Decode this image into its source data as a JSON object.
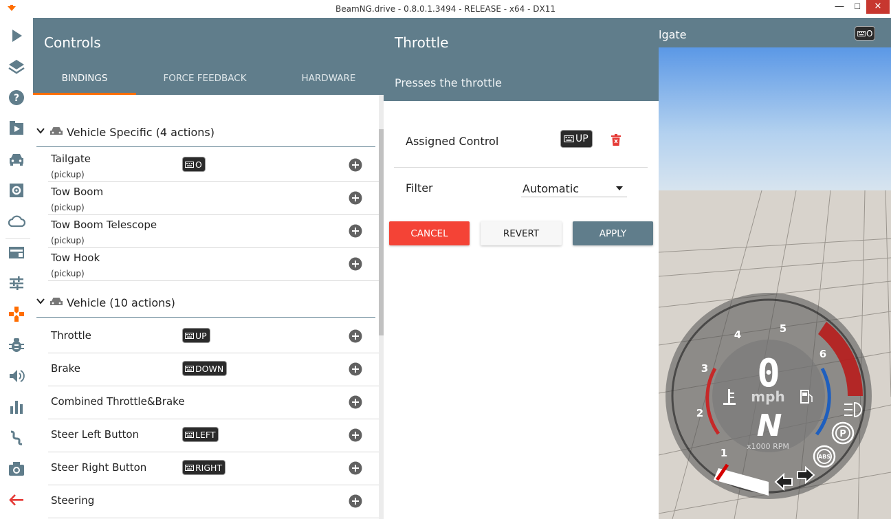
{
  "window": {
    "title": "BeamNG.drive - 0.8.0.1.3494 - RELEASE - x64 - DX11",
    "min_symbol": "—",
    "max_symbol": "□",
    "close_symbol": "✕"
  },
  "sidebar": {
    "items": [
      {
        "icon": "play-icon"
      },
      {
        "icon": "layers-icon"
      },
      {
        "icon": "help-icon"
      },
      {
        "icon": "scenario-icon"
      },
      {
        "icon": "car-icon"
      },
      {
        "icon": "vehicle-config-icon"
      },
      {
        "icon": "weather-cloud-icon"
      },
      {
        "icon": "ui-apps-icon"
      },
      {
        "icon": "options-sliders-icon"
      },
      {
        "icon": "controls-gamepad-icon",
        "active": true
      },
      {
        "icon": "debug-bug-icon"
      },
      {
        "icon": "audio-volume-icon"
      },
      {
        "icon": "performance-chart-icon"
      },
      {
        "icon": "track-builder-icon"
      },
      {
        "icon": "camera-icon"
      },
      {
        "icon": "back-arrow-icon"
      }
    ],
    "accent_color": "#ff6d00"
  },
  "controls": {
    "title": "Controls",
    "tabs": [
      {
        "label": "BINDINGS",
        "active": true
      },
      {
        "label": "FORCE FEEDBACK"
      },
      {
        "label": "HARDWARE"
      }
    ],
    "header_color": "#607d8b",
    "groups": [
      {
        "label": "Vehicle Specific (4 actions)",
        "actions": [
          {
            "name": "Tailgate",
            "sub": "(pickup)",
            "key": "O"
          },
          {
            "name": "Tow Boom",
            "sub": "(pickup)",
            "key": ""
          },
          {
            "name": "Tow Boom Telescope",
            "sub": "(pickup)",
            "key": ""
          },
          {
            "name": "Tow Hook",
            "sub": "(pickup)",
            "key": ""
          }
        ]
      },
      {
        "label": "Vehicle (10 actions)",
        "actions": [
          {
            "name": "Throttle",
            "key": "UP"
          },
          {
            "name": "Brake",
            "key": "DOWN"
          },
          {
            "name": "Combined Throttle&Brake",
            "key": ""
          },
          {
            "name": "Steer Left Button",
            "key": "LEFT"
          },
          {
            "name": "Steer Right Button",
            "key": "RIGHT"
          },
          {
            "name": "Steering",
            "key": ""
          }
        ]
      }
    ]
  },
  "throttle": {
    "title": "Throttle",
    "description": "Presses the throttle",
    "assigned_label": "Assigned Control",
    "assigned_key": "UP",
    "filter_label": "Filter",
    "filter_value": "Automatic",
    "buttons": {
      "cancel": "CANCEL",
      "revert": "REVERT",
      "apply": "APPLY"
    },
    "colors": {
      "cancel": "#f44336",
      "apply": "#607d8b",
      "delete": "#e53935"
    }
  },
  "hud": {
    "label": "lgate",
    "key": "O",
    "speed": "0",
    "speed_unit": "mph",
    "gear": "N",
    "rpm_label": "x1000 RPM",
    "rpm_ticks": [
      "1",
      "2",
      "3",
      "4",
      "5",
      "6"
    ],
    "rpm": 0,
    "indicators": [
      "coolant-temp-icon",
      "fuel-icon",
      "headlight-icon",
      "parking-brake-icon",
      "abs-icon",
      "turn-left-icon",
      "turn-right-icon"
    ],
    "parking_label": "P",
    "abs_label": "ABS"
  }
}
